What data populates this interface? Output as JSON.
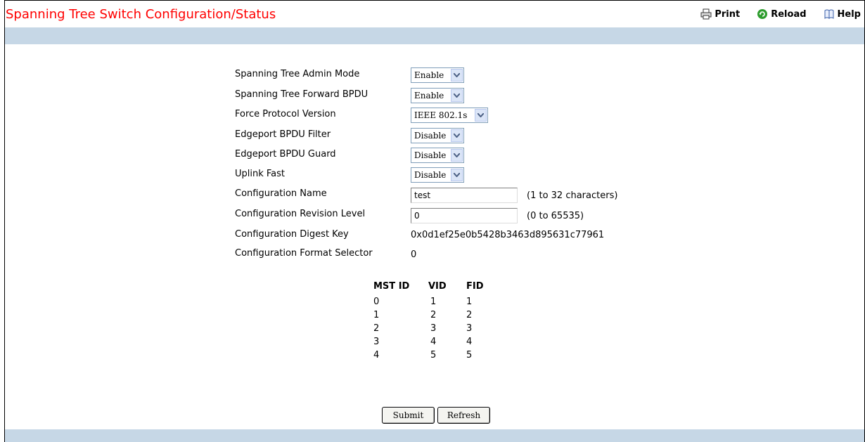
{
  "page": {
    "title": "Spanning Tree Switch Configuration/Status"
  },
  "toolbar": {
    "print": "Print",
    "reload": "Reload",
    "help": "Help"
  },
  "form": {
    "admin_mode": {
      "label": "Spanning Tree Admin Mode",
      "value": "Enable"
    },
    "forward_bpdu": {
      "label": "Spanning Tree Forward BPDU",
      "value": "Enable"
    },
    "protocol_version": {
      "label": "Force Protocol Version",
      "value": "IEEE 802.1s"
    },
    "bpdu_filter": {
      "label": "Edgeport BPDU Filter",
      "value": "Disable"
    },
    "bpdu_guard": {
      "label": "Edgeport BPDU Guard",
      "value": "Disable"
    },
    "uplink_fast": {
      "label": "Uplink Fast",
      "value": "Disable"
    },
    "config_name": {
      "label": "Configuration Name",
      "value": "test",
      "hint": "(1 to 32 characters)"
    },
    "revision_level": {
      "label": "Configuration Revision Level",
      "value": "0",
      "hint": "(0 to 65535)"
    },
    "digest_key": {
      "label": "Configuration Digest Key",
      "value": "0x0d1ef25e0b5428b3463d895631c77961"
    },
    "format_selector": {
      "label": "Configuration Format Selector",
      "value": "0"
    }
  },
  "mst_table": {
    "headers": [
      "MST ID",
      "VID",
      "FID"
    ],
    "rows": [
      [
        "0",
        "1",
        "1"
      ],
      [
        "1",
        "2",
        "2"
      ],
      [
        "2",
        "3",
        "3"
      ],
      [
        "3",
        "4",
        "4"
      ],
      [
        "4",
        "5",
        "5"
      ]
    ]
  },
  "buttons": {
    "submit": "Submit",
    "refresh": "Refresh"
  },
  "colors": {
    "title": "#ff0000",
    "bar": "#c6d7e6"
  }
}
